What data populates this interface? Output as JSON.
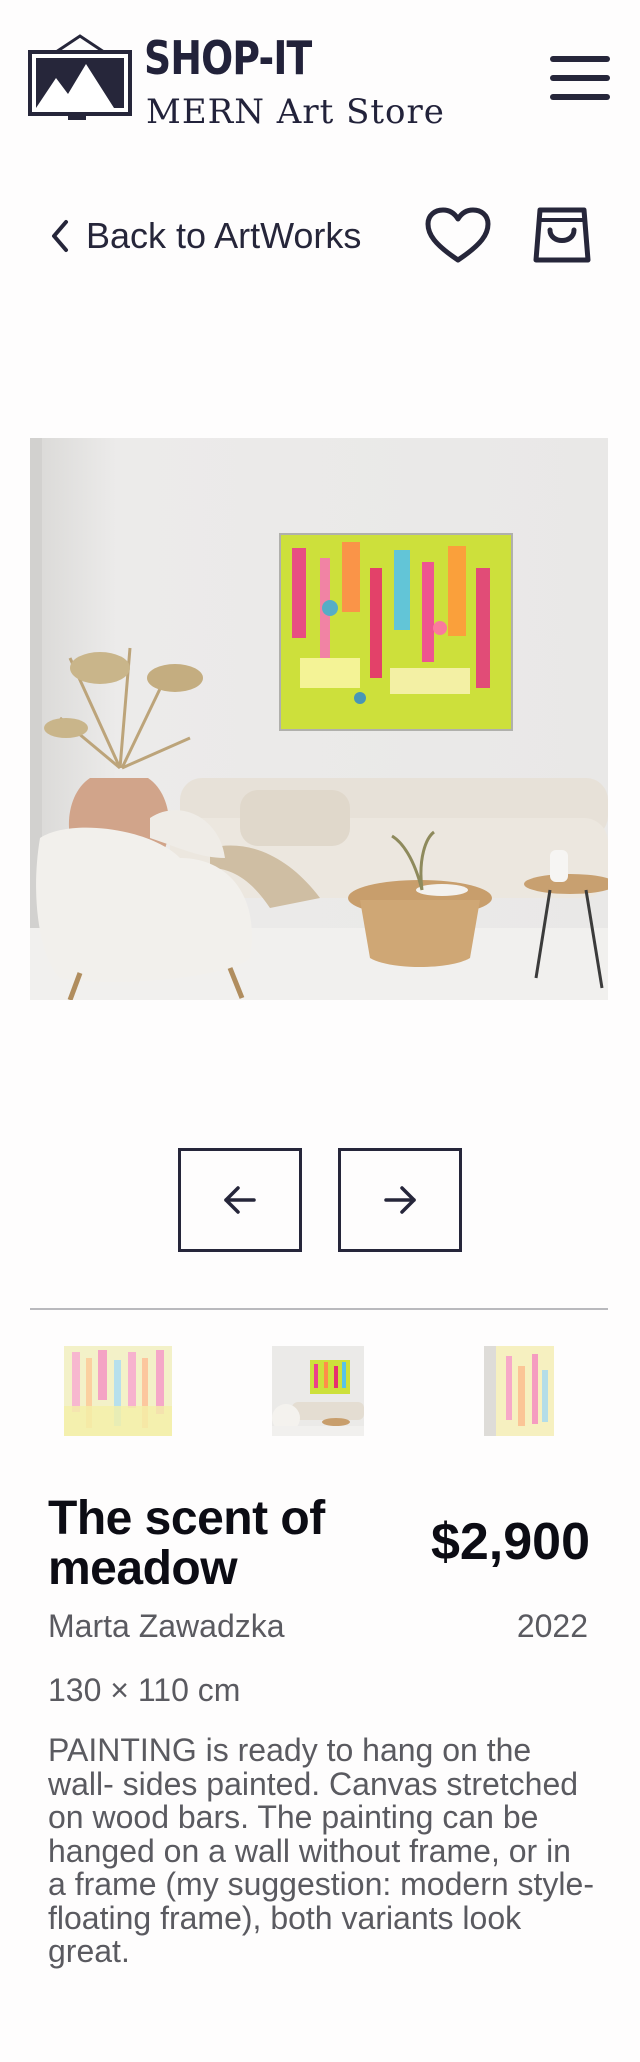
{
  "header": {
    "brand_title": "SHOP-IT",
    "brand_subtitle": "MERN Art Store",
    "logo_icon": "mountain-frame-icon",
    "menu_icon": "hamburger-menu-icon"
  },
  "nav": {
    "back_label": "Back to ArtWorks",
    "back_icon": "chevron-left-icon",
    "favorite_icon": "heart-icon",
    "cart_icon": "shopping-bag-icon"
  },
  "gallery": {
    "prev_icon": "arrow-left-icon",
    "next_icon": "arrow-right-icon",
    "thumbnails": [
      "painting-closeup",
      "painting-in-room",
      "painting-angle-detail"
    ],
    "selected_index": 1
  },
  "product": {
    "title": "The scent of meadow",
    "price": "$2,900",
    "artist": "Marta Zawadzka",
    "year": "2022",
    "dimensions": "130 × 110 cm",
    "description": "PAINTING is ready to hang on the wall- sides painted. Canvas stretched on wood bars. The painting can be hanged on a wall without frame, or in a frame (my suggestion: modern style-floating frame), both variants look great."
  },
  "colors": {
    "ink": "#26263a",
    "background": "#fefdfd",
    "muted_text": "#5a5a60",
    "divider": "#b9b9bd"
  }
}
